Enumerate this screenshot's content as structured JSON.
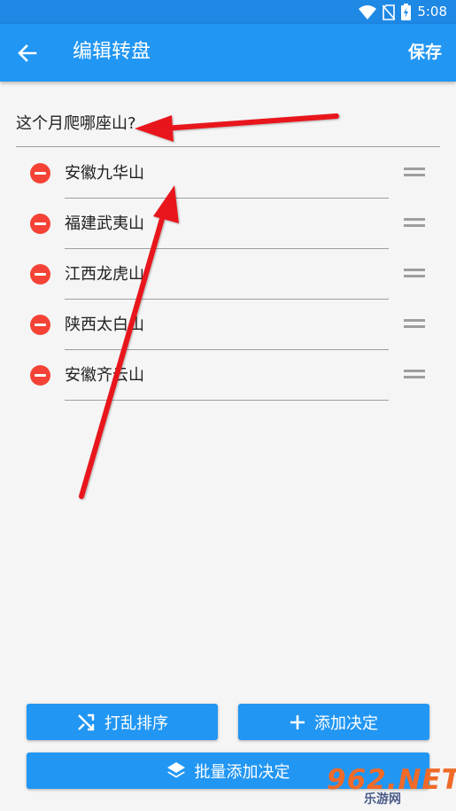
{
  "status_bar": {
    "time": "5:08",
    "icons": [
      "wifi-icon",
      "no-sim-icon",
      "battery-charging-icon"
    ]
  },
  "app_bar": {
    "back_icon": "arrow-back-icon",
    "title": "编辑转盘",
    "save_label": "保存"
  },
  "question": {
    "value": "这个月爬哪座山?"
  },
  "options": [
    {
      "label": "安徽九华山"
    },
    {
      "label": "福建武夷山"
    },
    {
      "label": "江西龙虎山"
    },
    {
      "label": "陕西太白山"
    },
    {
      "label": "安徽齐云山"
    }
  ],
  "buttons": {
    "shuffle_label": "打乱排序",
    "add_label": "添加决定",
    "batch_add_label": "批量添加决定"
  },
  "watermark": {
    "main": "962.NET",
    "sub": "乐游网"
  },
  "colors": {
    "primary": "#2196f3",
    "status_bar": "#1e88e5",
    "delete": "#f44336",
    "annotation_arrow": "#e8171b"
  }
}
